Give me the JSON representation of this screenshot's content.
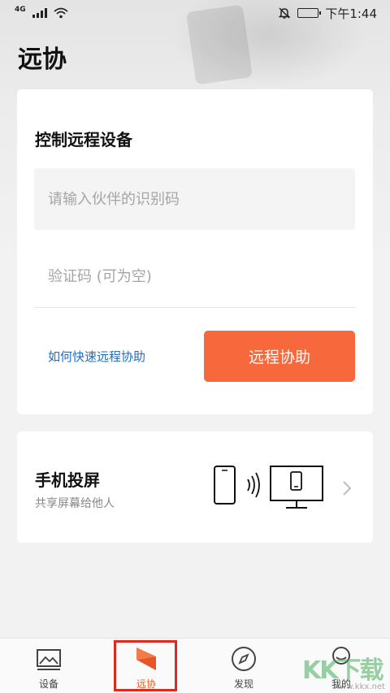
{
  "status_bar": {
    "network": "4G",
    "time": "下午1:44",
    "icons": [
      "signal-icon",
      "wifi-icon",
      "mute-bell-icon",
      "battery-icon"
    ]
  },
  "page": {
    "title": "远协"
  },
  "remote_card": {
    "title": "控制远程设备",
    "partner_id_placeholder": "请输入伙伴的识别码",
    "partner_id_value": "",
    "verify_code_placeholder": "验证码 (可为空)",
    "verify_code_value": "",
    "help_link": "如何快速远程协助",
    "assist_button": "远程协助"
  },
  "cast_card": {
    "title": "手机投屏",
    "subtitle": "共享屏幕给他人",
    "icons": [
      "phone-icon",
      "wireless-waves-icon",
      "monitor-icon",
      "chevron-right-icon"
    ]
  },
  "bottom_nav": {
    "items": [
      {
        "label": "设备",
        "icon": "device-picture-icon",
        "active": false
      },
      {
        "label": "远协",
        "icon": "remote-assist-logo-icon",
        "active": true
      },
      {
        "label": "发现",
        "icon": "compass-icon",
        "active": false
      },
      {
        "label": "我的",
        "icon": "profile-icon",
        "active": false
      }
    ]
  },
  "watermark": {
    "text": "KK下载",
    "url": "www.kkx.net"
  },
  "colors": {
    "accent": "#f7683d",
    "link": "#1f6fc4",
    "active_nav": "#f05a28",
    "highlight_box": "#e0281e",
    "background": "#f2f2f2"
  }
}
